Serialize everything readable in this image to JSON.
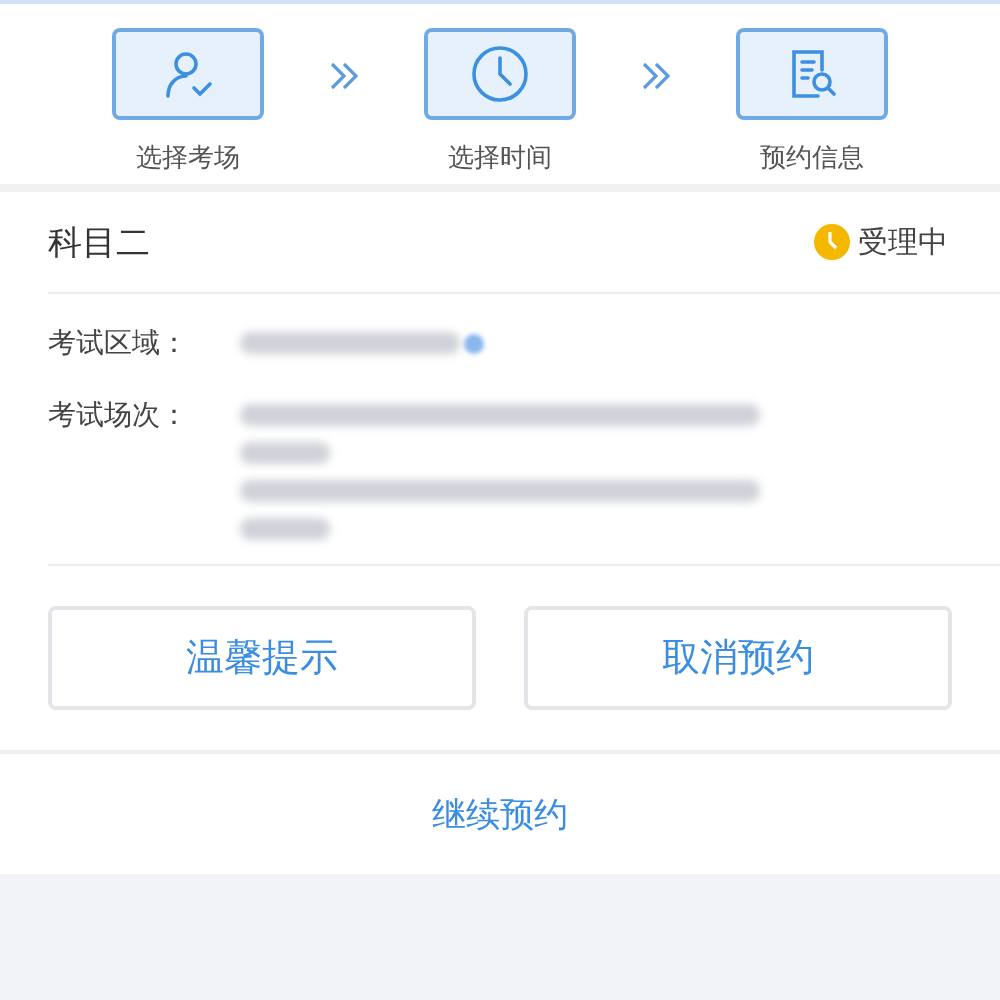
{
  "steps": [
    {
      "label": "选择考场"
    },
    {
      "label": "选择时间"
    },
    {
      "label": "预约信息"
    }
  ],
  "subject": {
    "title": "科目二",
    "status": "受理中"
  },
  "details": [
    {
      "label": "考试区域：",
      "lines": [
        {
          "kind": "short_dot"
        }
      ]
    },
    {
      "label": "考试场次：",
      "lines": [
        {
          "kind": "long"
        },
        {
          "kind": "tiny"
        },
        {
          "kind": "long"
        },
        {
          "kind": "tiny"
        }
      ]
    }
  ],
  "buttons": [
    "温馨提示",
    "取消预约"
  ],
  "link": "继续预约"
}
